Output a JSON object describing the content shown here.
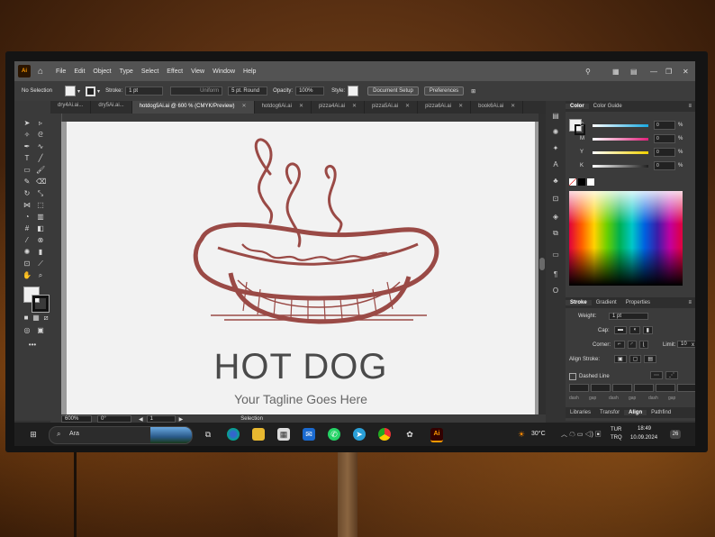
{
  "app": {
    "logo": "Ai",
    "home_icon": "home-icon"
  },
  "menu": [
    "File",
    "Edit",
    "Object",
    "Type",
    "Select",
    "Effect",
    "View",
    "Window",
    "Help"
  ],
  "control_bar": {
    "selection": "No Selection",
    "stroke_label": "Stroke:",
    "stroke_value": "1 pt",
    "brush": "Uniform",
    "brush_size": "5 pt. Round",
    "opacity_label": "Opacity:",
    "opacity_value": "100%",
    "style_label": "Style:",
    "document_setup": "Document Setup",
    "preferences": "Preferences"
  },
  "tabs": [
    {
      "label": "dry4Ai.ai...",
      "active": false
    },
    {
      "label": "dry5Ai.ai...",
      "active": false
    },
    {
      "label": "hotdog5Ai.ai @ 600 % (CMYK/Preview)",
      "active": true
    },
    {
      "label": "hotdog6Ai.ai",
      "active": false
    },
    {
      "label": "pizza4Ai.ai",
      "active": false
    },
    {
      "label": "pizza5Ai.ai",
      "active": false
    },
    {
      "label": "pizza6Ai.ai",
      "active": false
    },
    {
      "label": "book6Ai.ai",
      "active": false
    }
  ],
  "artwork": {
    "title": "HOT DOG",
    "tagline": "Your Tagline Goes Here",
    "color": "#9a4a46"
  },
  "status": {
    "zoom": "600%",
    "rotation": "0°",
    "artboard": "1",
    "mode": "Selection"
  },
  "color_panel": {
    "tabs": [
      "Color",
      "Color Guide"
    ],
    "channels": [
      {
        "label": "C",
        "value": "0",
        "unit": "%",
        "color": "#18a8e0"
      },
      {
        "label": "M",
        "value": "0",
        "unit": "%",
        "color": "#e0207a"
      },
      {
        "label": "Y",
        "value": "0",
        "unit": "%",
        "color": "#f0d000"
      },
      {
        "label": "K",
        "value": "0",
        "unit": "%",
        "color": "#202020"
      }
    ]
  },
  "stroke_panel": {
    "tabs": [
      "Stroke",
      "Gradient",
      "Properties"
    ],
    "weight_label": "Weight:",
    "weight_value": "1 pt",
    "cap_label": "Cap:",
    "corner_label": "Corner:",
    "limit_label": "Limit:",
    "limit_value": "10",
    "limit_unit": "x",
    "align_label": "Align Stroke:",
    "dashed_label": "Dashed Line",
    "dash_labels": [
      "dash",
      "gap",
      "dash",
      "gap",
      "dash",
      "gap"
    ]
  },
  "bottom_panel_tabs": [
    "Libraries",
    "Transfor",
    "Align",
    "Pathfind"
  ],
  "taskbar": {
    "search_placeholder": "Ara",
    "weather": "30°C",
    "lang_top": "TUR",
    "lang_bottom": "TRQ",
    "time": "18:49",
    "date": "10.09.2024",
    "notifications": "26"
  }
}
